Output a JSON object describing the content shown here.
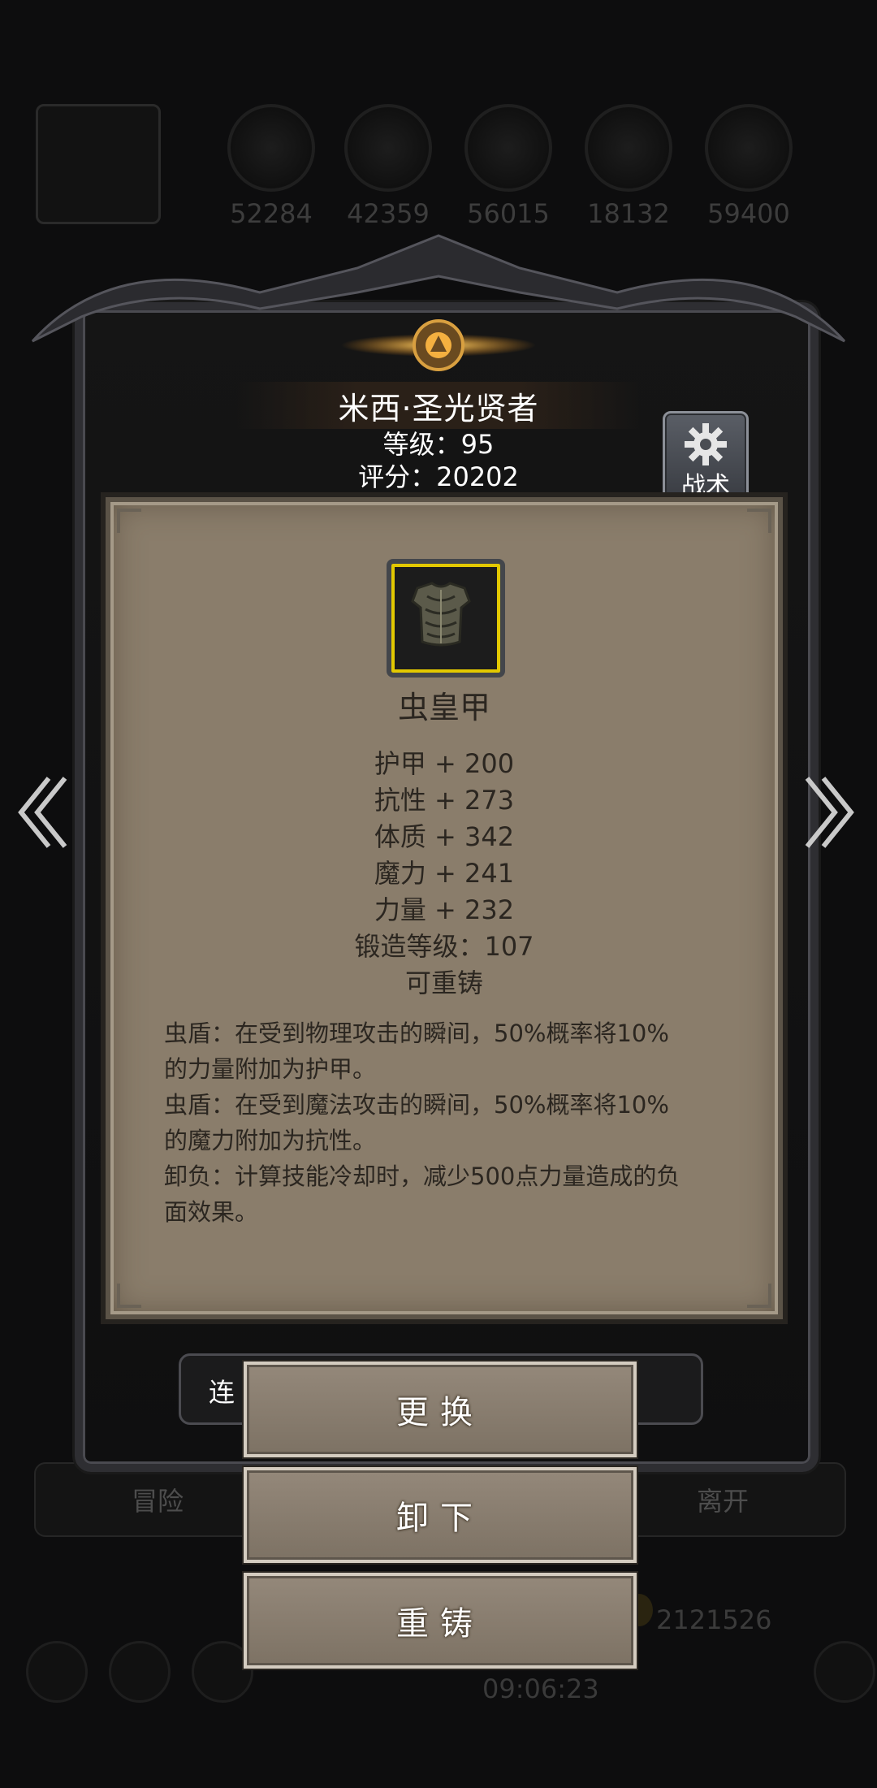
{
  "resources": [
    {
      "icon": "orange-ore-icon",
      "value": "52284"
    },
    {
      "icon": "striped-ore-icon",
      "value": "42359"
    },
    {
      "icon": "metal-ingot-icon",
      "value": "56015"
    },
    {
      "icon": "blue-crystal-icon",
      "value": "18132"
    },
    {
      "icon": "dark-ore-icon",
      "value": "59400"
    }
  ],
  "character": {
    "name": "米西·圣光贤者",
    "level": "等级：95",
    "score": "评分：20202",
    "tactics_label": "战术"
  },
  "item": {
    "name": "虫皇甲",
    "stats": [
      "护甲 + 200",
      "抗性 + 273",
      "体质 + 342",
      "魔力 + 241",
      "力量 + 232",
      "锻造等级：107",
      "可重铸"
    ],
    "description": [
      "虫盾：在受到物理攻击的瞬间，50%概率将10%",
      "的力量附加为护甲。",
      "虫盾：在受到魔法攻击的瞬间，50%概率将10%",
      "的魔力附加为抗性。",
      "卸负：计算技能冷却时，减少500点力量造成的负",
      "面效果。"
    ],
    "border_color": "#e2c800"
  },
  "actions": {
    "replace": "更换",
    "unequip": "卸下",
    "reforge": "重铸"
  },
  "background": {
    "row_left_text": "连",
    "tab_left": "冒险",
    "tab_right": "离开",
    "gold": "2121526",
    "clock": "09:06:23"
  }
}
